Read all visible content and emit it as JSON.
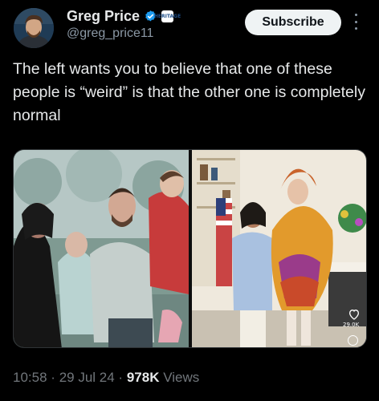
{
  "author": {
    "display_name": "Greg Price",
    "handle": "@greg_price11",
    "verified_icon": "verified-badge-icon",
    "affiliation_badge_text": "HERITAGE"
  },
  "actions": {
    "subscribe_label": "Subscribe",
    "more_icon": "more-vertical-icon"
  },
  "tweet": {
    "text": "The left wants you to believe that one of these people is “weird” is that the other one is completely normal"
  },
  "media": {
    "photo_left_subject": "family-photo",
    "photo_right_subject": "white-house-photo",
    "overlay": {
      "like_icon": "heart-icon",
      "views_text": "29.0K",
      "ring_icon": "circle-icon"
    }
  },
  "meta": {
    "time": "10:58",
    "separator": "·",
    "date": "29 Jul 24",
    "views_count": "978K",
    "views_label": "Views"
  },
  "colors": {
    "background": "#000000",
    "primary_text": "#e7e9ea",
    "secondary_text": "#71767b",
    "verified_blue": "#1d9bf0",
    "button_bg": "#eff3f4"
  }
}
